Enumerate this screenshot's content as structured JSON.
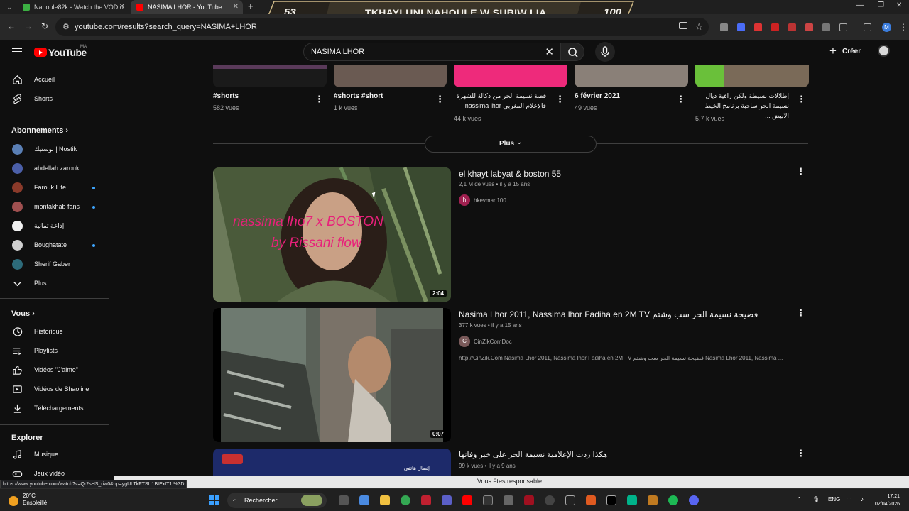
{
  "browser": {
    "tabs": [
      {
        "title": "Nahoule82k - Watch the VOD o",
        "active": false
      },
      {
        "title": "NASIMA LHOR - YouTube",
        "active": true
      }
    ],
    "url": "youtube.com/results?search_query=NASIMA+LHOR",
    "profile_initial": "M"
  },
  "overlay_banner": {
    "left_number": "53",
    "text": "TKHAYLUNI NAHOULE W SUBIW LIA",
    "right_number": "100"
  },
  "header": {
    "logo_text": "YouTube",
    "country_code": "MA",
    "search_query": "NASIMA LHOR",
    "create_label": "Créer"
  },
  "sidebar": {
    "main": [
      {
        "label": "Accueil",
        "icon": "home-icon"
      },
      {
        "label": "Shorts",
        "icon": "shorts-icon"
      }
    ],
    "subscriptions_title": "Abonnements",
    "subscriptions": [
      {
        "label": "نوستيك | Nostik",
        "dot": false
      },
      {
        "label": "abdellah zarouk",
        "dot": false
      },
      {
        "label": "Farouk Life",
        "dot": true
      },
      {
        "label": "montakhab fans",
        "dot": true
      },
      {
        "label": "إذاعة ثمانية",
        "dot": false
      },
      {
        "label": "Boughatate",
        "dot": true
      },
      {
        "label": "Sherif Gaber",
        "dot": false
      },
      {
        "label": "Plus",
        "dot": false
      }
    ],
    "you_title": "Vous",
    "you_items": [
      {
        "label": "Historique",
        "icon": "history-icon"
      },
      {
        "label": "Playlists",
        "icon": "playlist-icon"
      },
      {
        "label": "Vidéos \"J'aime\"",
        "icon": "like-icon"
      },
      {
        "label": "Vidéos de Shaoline",
        "icon": "your-videos-icon"
      },
      {
        "label": "Téléchargements",
        "icon": "download-icon"
      }
    ],
    "explore_title": "Explorer",
    "explore_items": [
      {
        "label": "Musique",
        "icon": "music-icon"
      },
      {
        "label": "Jeux vidéo",
        "icon": "gaming-icon"
      }
    ]
  },
  "shorts": [
    {
      "title": "#shorts",
      "views": "582 vues"
    },
    {
      "title": "#shorts #short",
      "views": "1 k vues"
    },
    {
      "title": "قصة نسيمة الحر من دكالة للشهرة فالإعلام المغربي nassima lhor",
      "views": "44 k vues"
    },
    {
      "title": "6 février 2021",
      "views": "49 vues"
    },
    {
      "title": "إطلالات بسيطة ولكن راقية ديال نسيمة الحر ساحبة برنامج الخيط الابيض ...",
      "views": "5,7 k vues"
    }
  ],
  "more_label": "Plus",
  "videos": [
    {
      "title": "el khayt labyat & boston 55",
      "meta": "2,1 M de vues • il y a 15 ans",
      "channel": "hkevman100",
      "channel_initial": "h",
      "duration": "2:04",
      "overlay_line1": "nassima lho7 x BOSTON",
      "overlay_line2": "by Rissani flow"
    },
    {
      "title": "Nasima Lhor 2011, Nassima lhor Fadiha en 2M TV فضيحة نسيمة الحر سب وشتم",
      "meta": "377 k vues • il y a 15 ans",
      "channel": "CinZikComDoc",
      "channel_initial": "C",
      "duration": "0:07",
      "description": "http://CinZik.Com Nasima Lhor 2011, Nassima lhor Fadiha en 2M TV فضيحة نسيمة الحر سب وشتم Nasima Lhor 2011, Nassima ..."
    },
    {
      "title": "هكذا ردت الإعلامية نسيمة الحر على خبر وفاتها",
      "meta": "99 k vues • il y a 9 ans",
      "thumb_text": "إتصال هاتفي"
    }
  ],
  "status_url": "https://www.youtube.com/watch?v=Qr2sHS_riw0&pp=ygULTkFTSU1BIExIT1I%3D",
  "screen_share_notice": "Vous êtes responsable",
  "taskbar": {
    "temperature": "20°C",
    "weather": "Ensoleillé",
    "search_label": "Rechercher",
    "language": "ENG",
    "time": "17:21",
    "date": "02/04/2026"
  },
  "colors": {
    "background": "#0f0f0f",
    "youtube_red": "#ff0000",
    "subscription_dot": "#3ea6ff",
    "text_primary": "#f1f1f1",
    "text_secondary": "#aaaaaa"
  }
}
